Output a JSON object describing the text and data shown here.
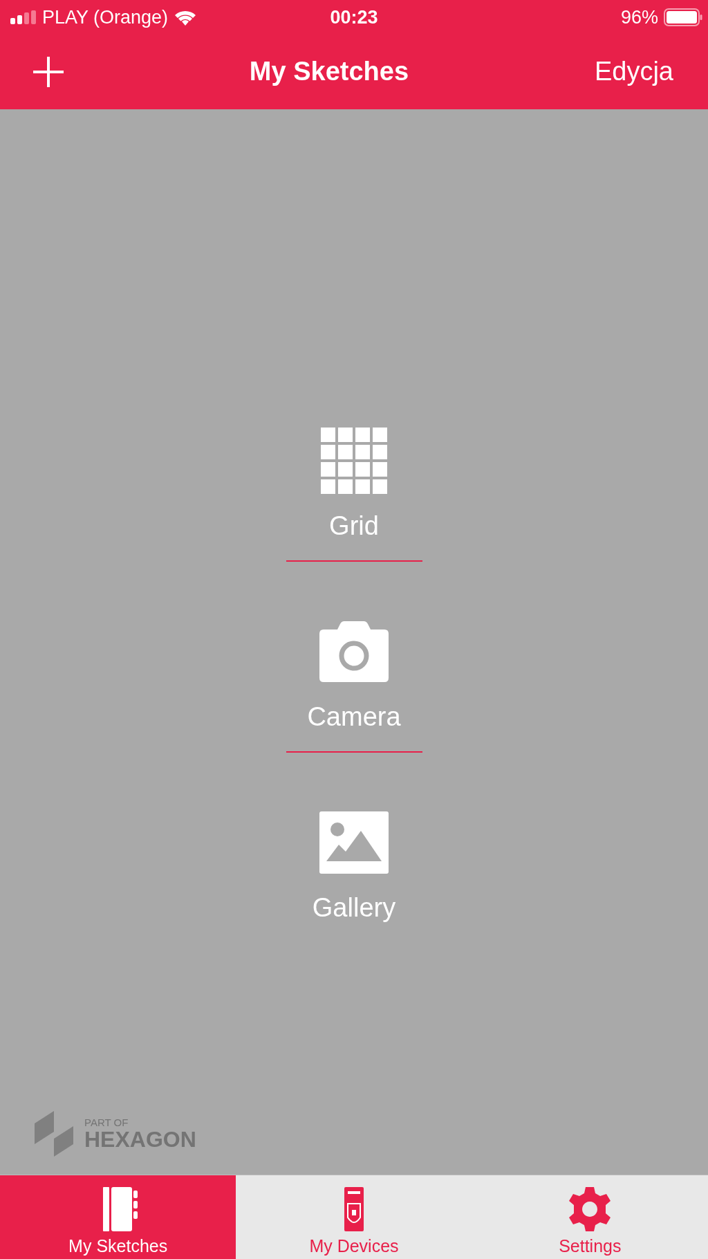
{
  "status_bar": {
    "carrier": "PLAY (Orange)",
    "time": "00:23",
    "battery": "96%"
  },
  "header": {
    "title": "My Sketches",
    "edit": "Edycja"
  },
  "menu": [
    {
      "label": "Grid",
      "kind": "grid"
    },
    {
      "label": "Camera",
      "kind": "camera"
    },
    {
      "label": "Gallery",
      "kind": "gallery"
    }
  ],
  "brand": {
    "line_1": "PART OF",
    "line_2": "HEXAGON"
  },
  "tabs": [
    {
      "label": "My Sketches",
      "kind": "sketches",
      "selected": true
    },
    {
      "label": "My Devices",
      "kind": "devices",
      "selected": false
    },
    {
      "label": "Settings",
      "kind": "settings",
      "selected": false
    }
  ]
}
